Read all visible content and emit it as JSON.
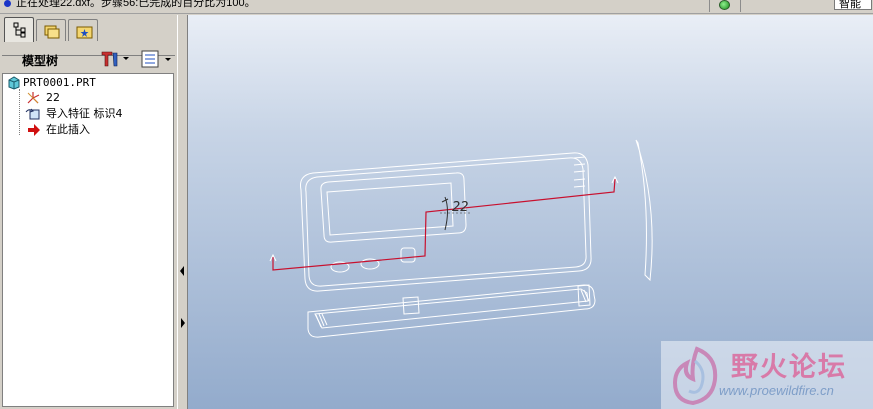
{
  "status": {
    "message": "正在处理22.dxf。步骤56:已完成的百分比为100。",
    "smart_filter": "智能"
  },
  "model_tree": {
    "tabs": [
      "model-tree-tab",
      "layer-tab",
      "favorites-tab"
    ],
    "title": "模型树",
    "items": [
      {
        "label": "PRT0001.PRT",
        "icon": "part-cube-icon"
      },
      {
        "label": "22",
        "icon": "datum-csys-icon"
      },
      {
        "label": "导入特征  标识4",
        "icon": "import-feature-icon"
      },
      {
        "label": "在此插入",
        "icon": "insert-here-arrow-icon"
      }
    ]
  },
  "viewport": {
    "csys_label": "22",
    "background_top": "#e9eef6",
    "background_bottom": "#93abcc",
    "sketch_color": "#ffffff",
    "polyline_color": "#c8102e"
  },
  "watermark": {
    "title": "野火论坛",
    "url": "www.proewildfire.cn"
  }
}
